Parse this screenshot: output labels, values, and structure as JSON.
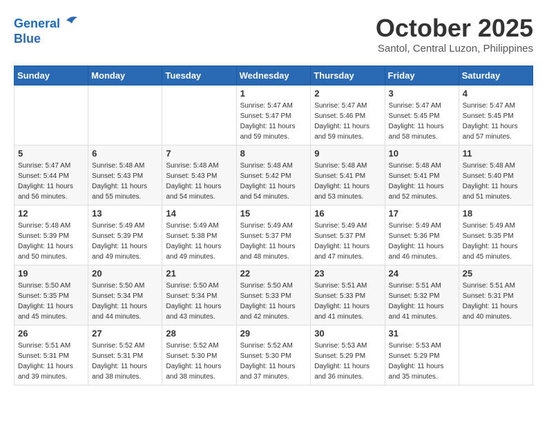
{
  "header": {
    "logo_line1": "General",
    "logo_line2": "Blue",
    "month": "October 2025",
    "location": "Santol, Central Luzon, Philippines"
  },
  "weekdays": [
    "Sunday",
    "Monday",
    "Tuesday",
    "Wednesday",
    "Thursday",
    "Friday",
    "Saturday"
  ],
  "weeks": [
    [
      {
        "day": "",
        "info": ""
      },
      {
        "day": "",
        "info": ""
      },
      {
        "day": "",
        "info": ""
      },
      {
        "day": "1",
        "info": "Sunrise: 5:47 AM\nSunset: 5:47 PM\nDaylight: 11 hours\nand 59 minutes."
      },
      {
        "day": "2",
        "info": "Sunrise: 5:47 AM\nSunset: 5:46 PM\nDaylight: 11 hours\nand 59 minutes."
      },
      {
        "day": "3",
        "info": "Sunrise: 5:47 AM\nSunset: 5:45 PM\nDaylight: 11 hours\nand 58 minutes."
      },
      {
        "day": "4",
        "info": "Sunrise: 5:47 AM\nSunset: 5:45 PM\nDaylight: 11 hours\nand 57 minutes."
      }
    ],
    [
      {
        "day": "5",
        "info": "Sunrise: 5:47 AM\nSunset: 5:44 PM\nDaylight: 11 hours\nand 56 minutes."
      },
      {
        "day": "6",
        "info": "Sunrise: 5:48 AM\nSunset: 5:43 PM\nDaylight: 11 hours\nand 55 minutes."
      },
      {
        "day": "7",
        "info": "Sunrise: 5:48 AM\nSunset: 5:43 PM\nDaylight: 11 hours\nand 54 minutes."
      },
      {
        "day": "8",
        "info": "Sunrise: 5:48 AM\nSunset: 5:42 PM\nDaylight: 11 hours\nand 54 minutes."
      },
      {
        "day": "9",
        "info": "Sunrise: 5:48 AM\nSunset: 5:41 PM\nDaylight: 11 hours\nand 53 minutes."
      },
      {
        "day": "10",
        "info": "Sunrise: 5:48 AM\nSunset: 5:41 PM\nDaylight: 11 hours\nand 52 minutes."
      },
      {
        "day": "11",
        "info": "Sunrise: 5:48 AM\nSunset: 5:40 PM\nDaylight: 11 hours\nand 51 minutes."
      }
    ],
    [
      {
        "day": "12",
        "info": "Sunrise: 5:48 AM\nSunset: 5:39 PM\nDaylight: 11 hours\nand 50 minutes."
      },
      {
        "day": "13",
        "info": "Sunrise: 5:49 AM\nSunset: 5:39 PM\nDaylight: 11 hours\nand 49 minutes."
      },
      {
        "day": "14",
        "info": "Sunrise: 5:49 AM\nSunset: 5:38 PM\nDaylight: 11 hours\nand 49 minutes."
      },
      {
        "day": "15",
        "info": "Sunrise: 5:49 AM\nSunset: 5:37 PM\nDaylight: 11 hours\nand 48 minutes."
      },
      {
        "day": "16",
        "info": "Sunrise: 5:49 AM\nSunset: 5:37 PM\nDaylight: 11 hours\nand 47 minutes."
      },
      {
        "day": "17",
        "info": "Sunrise: 5:49 AM\nSunset: 5:36 PM\nDaylight: 11 hours\nand 46 minutes."
      },
      {
        "day": "18",
        "info": "Sunrise: 5:49 AM\nSunset: 5:35 PM\nDaylight: 11 hours\nand 45 minutes."
      }
    ],
    [
      {
        "day": "19",
        "info": "Sunrise: 5:50 AM\nSunset: 5:35 PM\nDaylight: 11 hours\nand 45 minutes."
      },
      {
        "day": "20",
        "info": "Sunrise: 5:50 AM\nSunset: 5:34 PM\nDaylight: 11 hours\nand 44 minutes."
      },
      {
        "day": "21",
        "info": "Sunrise: 5:50 AM\nSunset: 5:34 PM\nDaylight: 11 hours\nand 43 minutes."
      },
      {
        "day": "22",
        "info": "Sunrise: 5:50 AM\nSunset: 5:33 PM\nDaylight: 11 hours\nand 42 minutes."
      },
      {
        "day": "23",
        "info": "Sunrise: 5:51 AM\nSunset: 5:33 PM\nDaylight: 11 hours\nand 41 minutes."
      },
      {
        "day": "24",
        "info": "Sunrise: 5:51 AM\nSunset: 5:32 PM\nDaylight: 11 hours\nand 41 minutes."
      },
      {
        "day": "25",
        "info": "Sunrise: 5:51 AM\nSunset: 5:31 PM\nDaylight: 11 hours\nand 40 minutes."
      }
    ],
    [
      {
        "day": "26",
        "info": "Sunrise: 5:51 AM\nSunset: 5:31 PM\nDaylight: 11 hours\nand 39 minutes."
      },
      {
        "day": "27",
        "info": "Sunrise: 5:52 AM\nSunset: 5:31 PM\nDaylight: 11 hours\nand 38 minutes."
      },
      {
        "day": "28",
        "info": "Sunrise: 5:52 AM\nSunset: 5:30 PM\nDaylight: 11 hours\nand 38 minutes."
      },
      {
        "day": "29",
        "info": "Sunrise: 5:52 AM\nSunset: 5:30 PM\nDaylight: 11 hours\nand 37 minutes."
      },
      {
        "day": "30",
        "info": "Sunrise: 5:53 AM\nSunset: 5:29 PM\nDaylight: 11 hours\nand 36 minutes."
      },
      {
        "day": "31",
        "info": "Sunrise: 5:53 AM\nSunset: 5:29 PM\nDaylight: 11 hours\nand 35 minutes."
      },
      {
        "day": "",
        "info": ""
      }
    ]
  ]
}
